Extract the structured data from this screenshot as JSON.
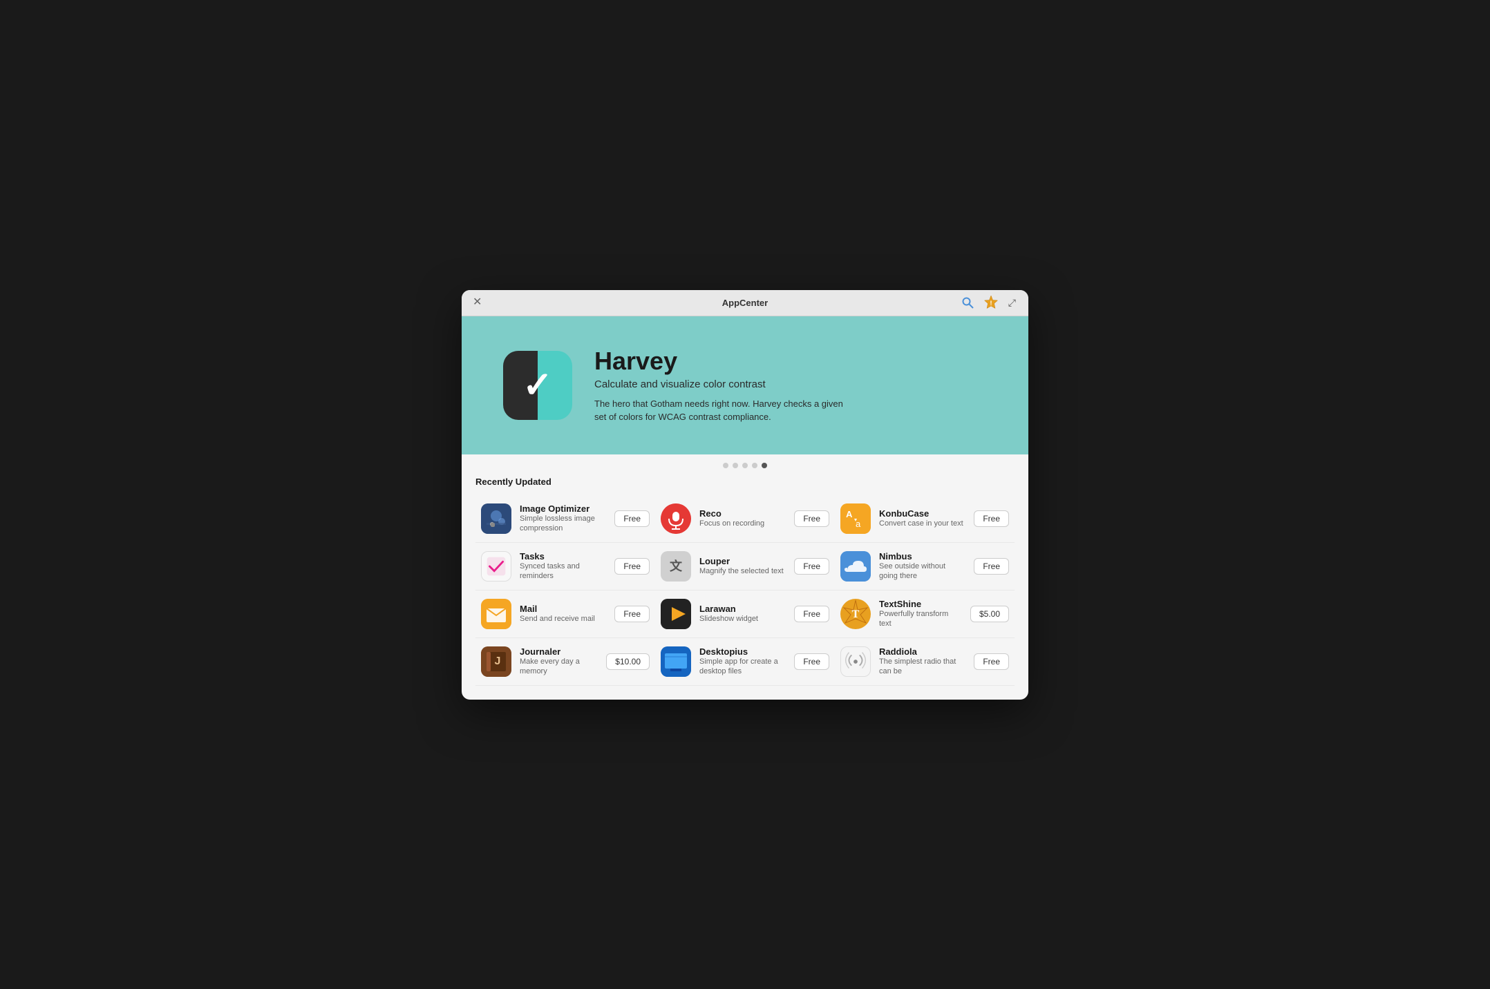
{
  "window": {
    "title": "AppCenter",
    "close_label": "✕"
  },
  "hero": {
    "app_name": "Harvey",
    "app_subtitle": "Calculate and visualize color contrast",
    "app_description": "The hero that Gotham needs right now. Harvey checks a given set of colors for WCAG contrast compliance.",
    "checkmark": "✓"
  },
  "dots": [
    {
      "active": false
    },
    {
      "active": false
    },
    {
      "active": false
    },
    {
      "active": false
    },
    {
      "active": true
    }
  ],
  "section_title": "Recently Updated",
  "apps": [
    {
      "id": "image-optimizer",
      "name": "Image Optimizer",
      "desc": "Simple lossless image compression",
      "price": "Free",
      "icon_text": "🖼",
      "icon_class": "icon-image-optimizer"
    },
    {
      "id": "reco",
      "name": "Reco",
      "desc": "Focus on recording",
      "price": "Free",
      "icon_text": "🎙",
      "icon_class": "icon-reco"
    },
    {
      "id": "konbucase",
      "name": "KonbuCase",
      "desc": "Convert case in your text",
      "price": "Free",
      "icon_text": "Aa",
      "icon_class": "icon-konbucase"
    },
    {
      "id": "tasks",
      "name": "Tasks",
      "desc": "Synced tasks and reminders",
      "price": "Free",
      "icon_text": "✓",
      "icon_class": "icon-tasks"
    },
    {
      "id": "louper",
      "name": "Louper",
      "desc": "Magnify the selected text",
      "price": "Free",
      "icon_text": "文",
      "icon_class": "icon-louper"
    },
    {
      "id": "nimbus",
      "name": "Nimbus",
      "desc": "See outside without going there",
      "price": "Free",
      "icon_text": "☁",
      "icon_class": "icon-nimbus"
    },
    {
      "id": "mail",
      "name": "Mail",
      "desc": "Send and receive mail",
      "price": "Free",
      "icon_text": "✉",
      "icon_class": "icon-mail"
    },
    {
      "id": "larawan",
      "name": "Larawan",
      "desc": "Slideshow widget",
      "price": "Free",
      "icon_text": "▶",
      "icon_class": "icon-larawan"
    },
    {
      "id": "textshine",
      "name": "TextShine",
      "desc": "Powerfully transform text",
      "price": "$5.00",
      "icon_text": "T",
      "icon_class": "icon-textshine"
    },
    {
      "id": "journaler",
      "name": "Journaler",
      "desc": "Make every day a memory",
      "price": "$10.00",
      "icon_text": "J",
      "icon_class": "icon-journaler"
    },
    {
      "id": "desktopius",
      "name": "Desktopius",
      "desc": "Simple app for create a desktop files",
      "price": "Free",
      "icon_text": "📁",
      "icon_class": "icon-desktopius"
    },
    {
      "id": "raddiola",
      "name": "Raddiola",
      "desc": "The simplest radio that can be",
      "price": "Free",
      "icon_text": "📡",
      "icon_class": "icon-raddiola"
    }
  ]
}
